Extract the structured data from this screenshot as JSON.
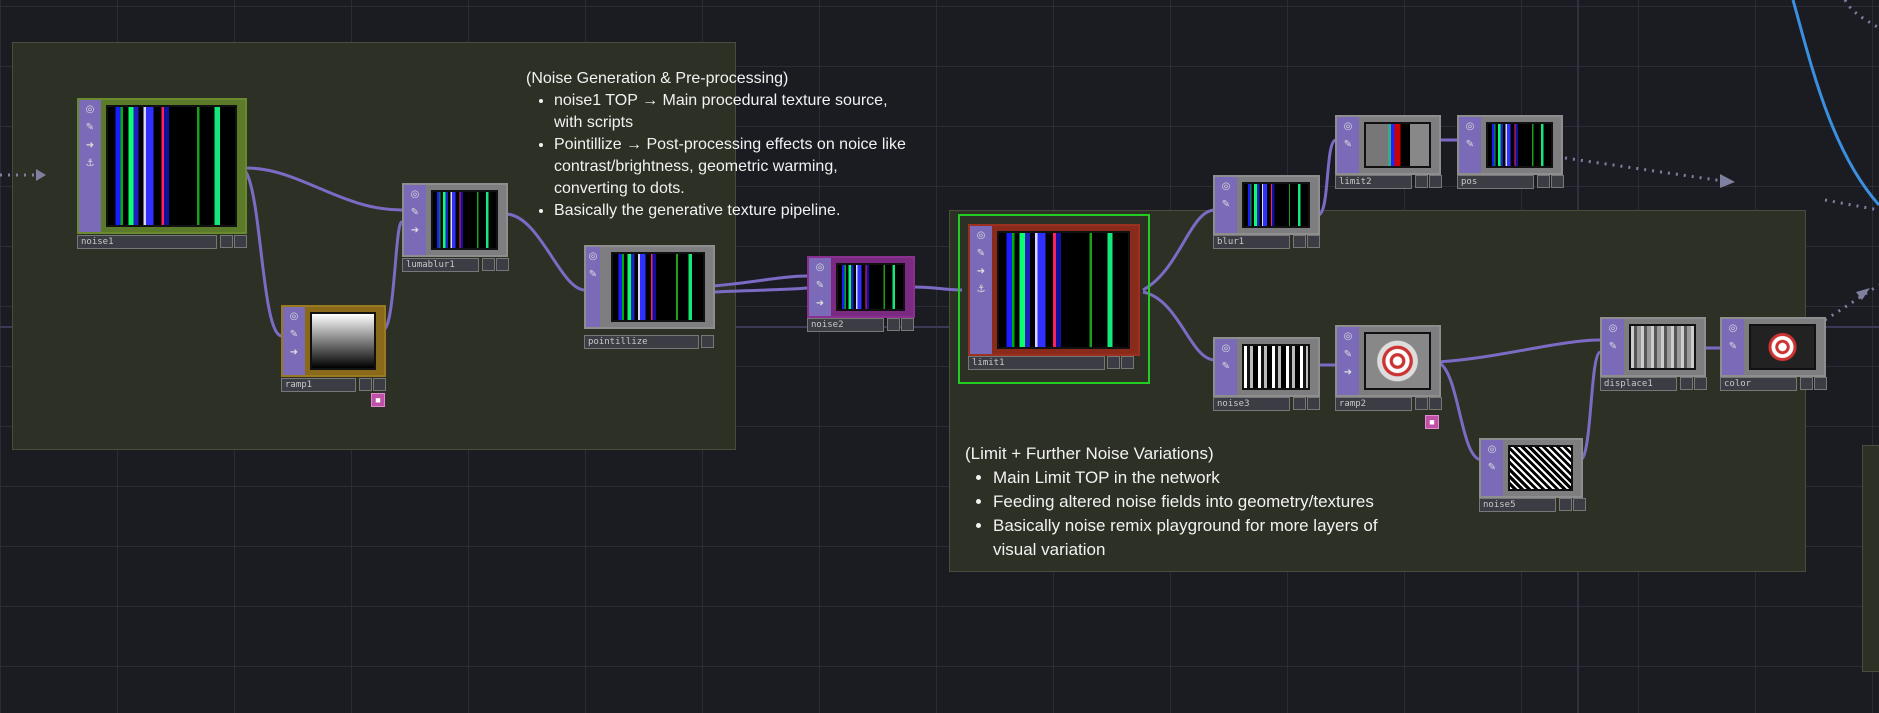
{
  "colors": {
    "background": "#1b1c21",
    "annotation_bg": "#2d3024",
    "wire": "#7b6bc4",
    "selected_outline": "#22cc22",
    "remote_wire": "#3a8fe0"
  },
  "annotations": {
    "left": {
      "title": "(Noise Generation & Pre-processing)",
      "bullets": [
        "noise1 TOP → Main procedural texture source, with scripts",
        "Pointillize → Post-processing effects on noice like contrast/brightness, geometric warming, converting to dots.",
        "Basically the generative texture pipeline."
      ]
    },
    "right": {
      "title": "(Limit + Further Noise Variations)",
      "bullets": [
        "Main Limit TOP in the network",
        "Feeding altered noise fields into geometry/textures",
        "Basically noise remix playground for more layers of visual variation"
      ]
    }
  },
  "nodes": {
    "noise1": "noise1",
    "ramp1": "ramp1",
    "lumablur1": "lumablur1",
    "pointillize": "pointillize",
    "noise2": "noise2",
    "limit1": "limit1",
    "blur1": "blur1",
    "limit2": "limit2",
    "pos": "pos",
    "noise3": "noise3",
    "ramp2": "ramp2",
    "noise5": "noise5",
    "displace1": "displace1",
    "color": "color"
  },
  "icons": {
    "side_buttons": [
      "viewer-toggle-icon",
      "pen-icon",
      "arrow-right-icon",
      "lock-icon"
    ],
    "side_glyphs": [
      "◎",
      "✎",
      "➜",
      "⚓"
    ]
  }
}
